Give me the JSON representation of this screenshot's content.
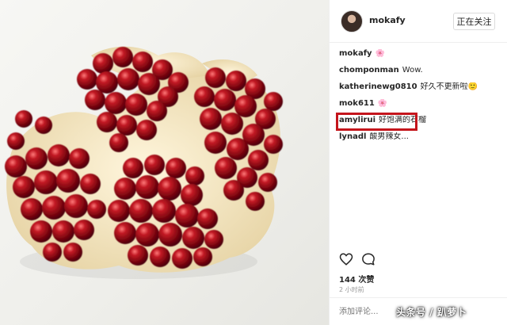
{
  "post": {
    "username": "mokafy",
    "follow_label": "正在关注",
    "caption_user": "mokafy",
    "caption_text": "🌸",
    "comments": [
      {
        "user": "chomponman",
        "text": "Wow."
      },
      {
        "user": "katherinewg0810",
        "text": "好久不更新啦🙂"
      },
      {
        "user": "mok611",
        "text": "🌸"
      },
      {
        "user": "amylirui",
        "text": "好饱满的石榴"
      },
      {
        "user": "lynadl",
        "text": "酸男辣女..."
      }
    ],
    "likes": "144 次赞",
    "time": "2 小时前",
    "comment_placeholder": "添加评论...",
    "watermark": "头条号 / 趴萝卜"
  },
  "colors": {
    "highlight": "#c4151c",
    "fruit": "#8e0a14",
    "rind": "#f1e6c8"
  },
  "icons": [
    "avatar",
    "heart-icon",
    "comment-icon",
    "ellipsis-icon"
  ]
}
